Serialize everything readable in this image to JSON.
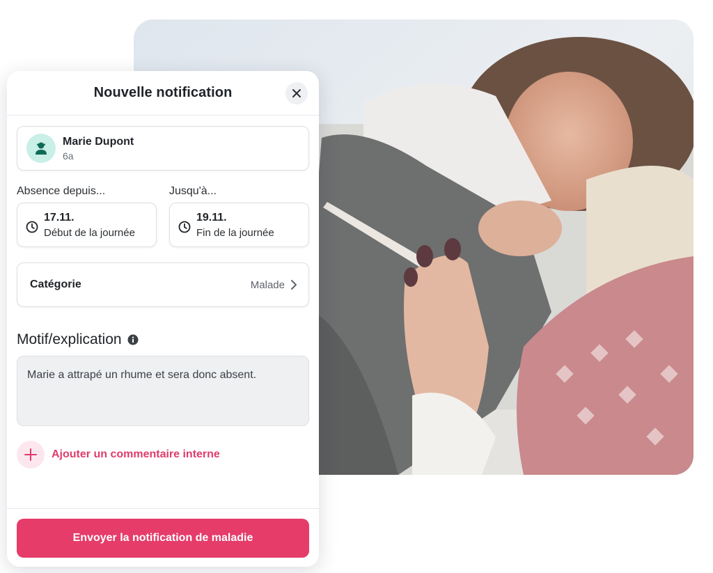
{
  "dialog": {
    "title": "Nouvelle notification",
    "close_icon": "close-icon"
  },
  "person": {
    "name": "Marie Dupont",
    "class": "6a",
    "avatar_icon": "student-avatar-icon"
  },
  "absence": {
    "from_label": "Absence depuis...",
    "to_label": "Jusqu'à...",
    "from_date": "17.11.",
    "from_time": "Début de la journée",
    "to_date": "19.11.",
    "to_time": "Fin de la journée",
    "clock_icon": "clock-icon"
  },
  "category": {
    "label": "Catégorie",
    "value": "Malade",
    "chevron_icon": "chevron-right-icon"
  },
  "reason": {
    "title": "Motif/explication",
    "info_icon": "info-icon",
    "text": "Marie a attrapé un rhume et sera donc absent."
  },
  "comment": {
    "add_label": "Ajouter un commentaire interne",
    "plus_icon": "plus-icon"
  },
  "submit": {
    "label": "Envoyer la notification de maladie"
  },
  "colors": {
    "accent": "#e53c6a",
    "accent_text": "#e03c6b",
    "avatar_bg": "#c9efe6",
    "avatar_fg": "#0f6b57"
  }
}
